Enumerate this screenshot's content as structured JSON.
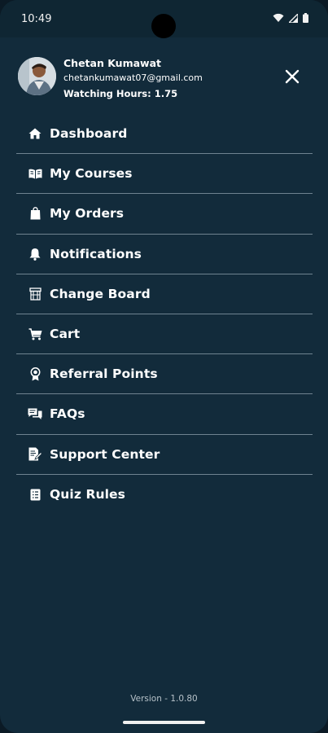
{
  "status_bar": {
    "time": "10:49"
  },
  "user": {
    "name": "Chetan Kumawat",
    "email": "chetankumawat07@gmail.com",
    "watching_hours": "Watching Hours: 1.75"
  },
  "menu": {
    "items": [
      {
        "label": "Dashboard",
        "icon": "home-icon"
      },
      {
        "label": "My Courses",
        "icon": "book-open-icon"
      },
      {
        "label": "My Orders",
        "icon": "shopping-bag-icon"
      },
      {
        "label": "Notifications",
        "icon": "bell-icon"
      },
      {
        "label": "Change Board",
        "icon": "board-icon"
      },
      {
        "label": "Cart",
        "icon": "cart-icon"
      },
      {
        "label": "Referral Points",
        "icon": "award-icon"
      },
      {
        "label": "FAQs",
        "icon": "chat-bubbles-icon"
      },
      {
        "label": "Support Center",
        "icon": "document-edit-icon"
      },
      {
        "label": "Quiz Rules",
        "icon": "list-document-icon"
      }
    ]
  },
  "footer": {
    "version": "Version - 1.0.80"
  },
  "colors": {
    "background": "#122b3b",
    "divider": "#6f8390",
    "text": "#ffffff"
  }
}
